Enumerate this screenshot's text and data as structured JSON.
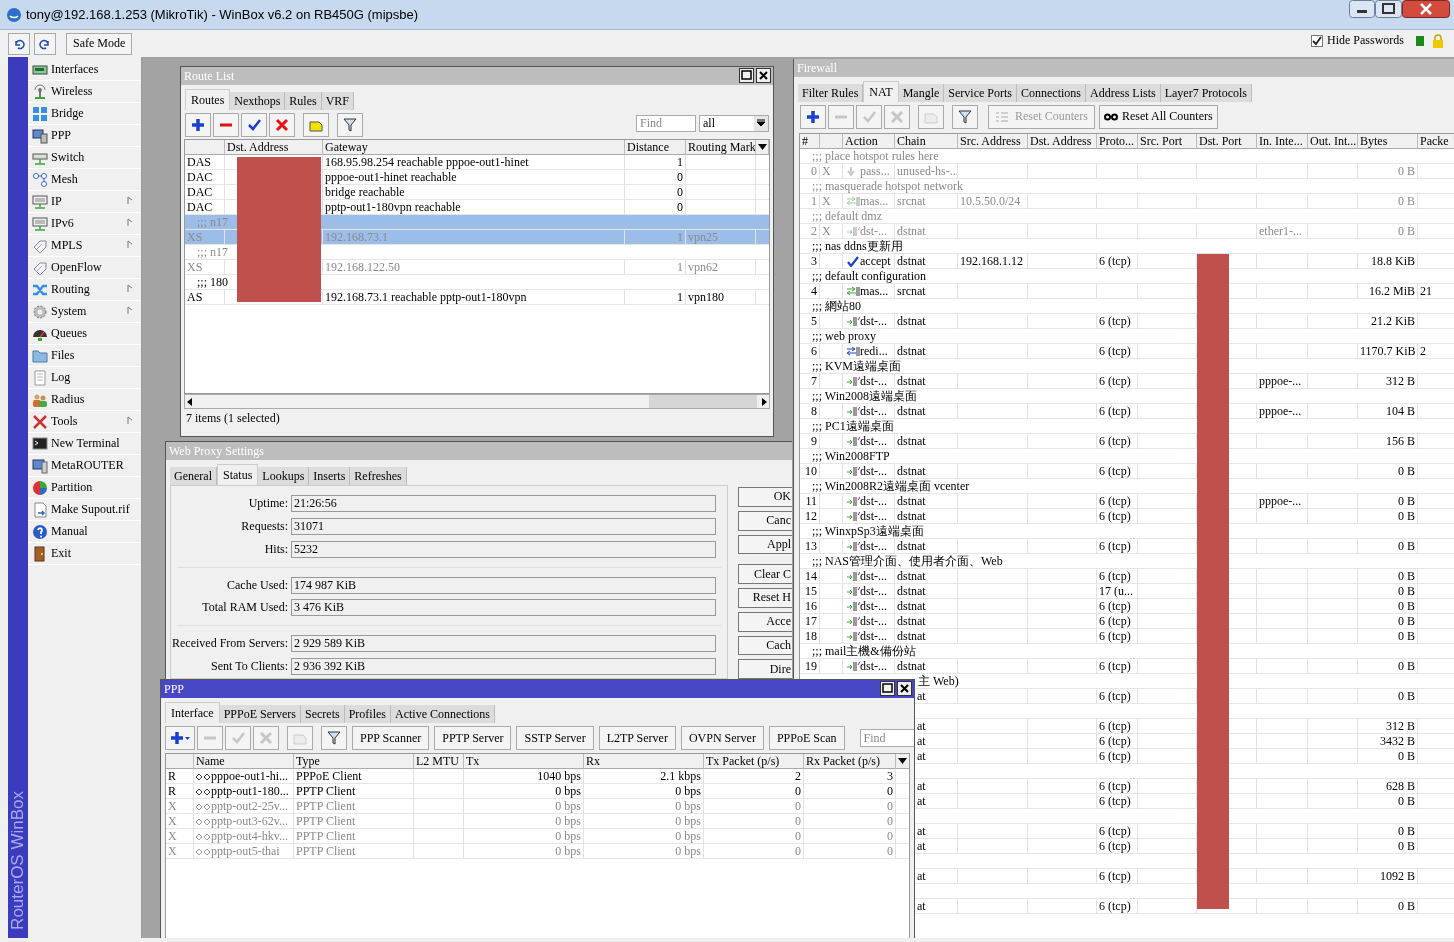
{
  "window": {
    "title": "tony@192.168.1.253 (MikroTik) - WinBox v6.2 on RB450G (mipsbe)"
  },
  "toolbar": {
    "safe_mode": "Safe Mode",
    "hide_passwords": {
      "label": "Hide Passwords",
      "checked": true
    }
  },
  "side_label": "RouterOS WinBox",
  "menu": [
    {
      "label": "Interfaces",
      "kind": "card",
      "submenu": false
    },
    {
      "label": "Wireless",
      "kind": "antenna",
      "submenu": false
    },
    {
      "label": "Bridge",
      "kind": "arrows",
      "submenu": false
    },
    {
      "label": "PPP",
      "kind": "computers",
      "submenu": false
    },
    {
      "label": "Switch",
      "kind": "switch",
      "submenu": false
    },
    {
      "label": "Mesh",
      "kind": "nodes",
      "submenu": false
    },
    {
      "label": "IP",
      "kind": "device",
      "submenu": true
    },
    {
      "label": "IPv6",
      "kind": "device",
      "submenu": true
    },
    {
      "label": "MPLS",
      "kind": "tag",
      "submenu": true
    },
    {
      "label": "OpenFlow",
      "kind": "tag",
      "submenu": false
    },
    {
      "label": "Routing",
      "kind": "crossed",
      "submenu": true
    },
    {
      "label": "System",
      "kind": "gear",
      "submenu": true
    },
    {
      "label": "Queues",
      "kind": "gauge",
      "submenu": false
    },
    {
      "label": "Files",
      "kind": "folder",
      "submenu": false
    },
    {
      "label": "Log",
      "kind": "document",
      "submenu": false
    },
    {
      "label": "Radius",
      "kind": "people",
      "submenu": false
    },
    {
      "label": "Tools",
      "kind": "tools",
      "submenu": true
    },
    {
      "label": "New Terminal",
      "kind": "terminal",
      "submenu": false
    },
    {
      "label": "MetaROUTER",
      "kind": "monitor",
      "submenu": false
    },
    {
      "label": "Partition",
      "kind": "pie",
      "submenu": false
    },
    {
      "label": "Make Supout.rif",
      "kind": "file",
      "submenu": false
    },
    {
      "label": "Manual",
      "kind": "help",
      "submenu": false
    },
    {
      "label": "Exit",
      "kind": "door",
      "submenu": false
    }
  ],
  "route_list": {
    "title": "Route List",
    "active": false,
    "tabs": [
      {
        "label": "Routes",
        "selected": true
      },
      {
        "label": "Nexthops",
        "selected": false
      },
      {
        "label": "Rules",
        "selected": false
      },
      {
        "label": "VRF",
        "selected": false
      }
    ],
    "tools": [
      {
        "kind": "add",
        "disabled": false
      },
      {
        "kind": "remove",
        "disabled": false
      },
      {
        "kind": "enable",
        "disabled": false
      },
      {
        "kind": "disable",
        "disabled": false
      },
      {
        "kind": "comment",
        "disabled": false
      },
      {
        "kind": "filter",
        "disabled": false
      }
    ],
    "find_placeholder": "Find",
    "filter": "all",
    "columns": [
      "Dst. Address",
      "Gateway",
      "Distance",
      "Routing Mark"
    ],
    "rows": [
      {
        "kind": "route",
        "flags": "DAS",
        "gateway": "168.95.98.254 reachable pppoe-out1-hinet",
        "distance": "1",
        "routing_mark": "",
        "selected": false,
        "disabled": false
      },
      {
        "kind": "route",
        "flags": "DAC",
        "gateway": "pppoe-out1-hinet reachable",
        "distance": "0",
        "routing_mark": "",
        "selected": false,
        "disabled": false
      },
      {
        "kind": "route",
        "flags": "DAC",
        "gateway": "bridge reachable",
        "distance": "0",
        "routing_mark": "",
        "selected": false,
        "disabled": false
      },
      {
        "kind": "route",
        "flags": "DAC",
        "gateway": "pptp-out1-180vpn reachable",
        "distance": "0",
        "routing_mark": "",
        "selected": false,
        "disabled": false
      },
      {
        "kind": "comment",
        "text": ";;; n17",
        "selected": true,
        "disabled": true
      },
      {
        "kind": "route",
        "flags": "XS",
        "gateway": "192.168.73.1",
        "distance": "1",
        "routing_mark": "vpn25",
        "selected": true,
        "disabled": true
      },
      {
        "kind": "comment",
        "text": ";;; n17",
        "selected": false,
        "disabled": true
      },
      {
        "kind": "route",
        "flags": "XS",
        "gateway": "192.168.122.50",
        "distance": "1",
        "routing_mark": "vpn62",
        "selected": false,
        "disabled": true
      },
      {
        "kind": "comment",
        "text": ";;; 180",
        "selected": false,
        "disabled": false
      },
      {
        "kind": "route",
        "flags": "AS",
        "gateway": "192.168.73.1 reachable pptp-out1-180vpn",
        "distance": "1",
        "routing_mark": "vpn180",
        "selected": false,
        "disabled": false
      }
    ],
    "status": "7 items (1 selected)"
  },
  "web_proxy": {
    "title": "Web Proxy Settings",
    "active": false,
    "tabs": [
      {
        "label": "General",
        "selected": false
      },
      {
        "label": "Status",
        "selected": true
      },
      {
        "label": "Lookups",
        "selected": false
      },
      {
        "label": "Inserts",
        "selected": false
      },
      {
        "label": "Refreshes",
        "selected": false
      }
    ],
    "groups": [
      [
        {
          "label": "Uptime:",
          "value": "21:26:56"
        },
        {
          "label": "Requests:",
          "value": "31071"
        },
        {
          "label": "Hits:",
          "value": "5232"
        }
      ],
      [
        {
          "label": "Cache Used:",
          "value": "174 987 KiB"
        },
        {
          "label": "Total RAM Used:",
          "value": "3 476 KiB"
        }
      ],
      [
        {
          "label": "Received From Servers:",
          "value": "2 929 589 KiB"
        },
        {
          "label": "Sent To Clients:",
          "value": "2 936 392 KiB"
        }
      ]
    ],
    "buttons": [
      "OK",
      "Canc",
      "Appl",
      "Clear C",
      "Reset H",
      "Acce",
      "Cach",
      "Dire"
    ]
  },
  "firewall": {
    "title": "Firewall",
    "active": false,
    "tabs": [
      {
        "label": "Filter Rules",
        "selected": false
      },
      {
        "label": "NAT",
        "selected": true
      },
      {
        "label": "Mangle",
        "selected": false
      },
      {
        "label": "Service Ports",
        "selected": false
      },
      {
        "label": "Connections",
        "selected": false
      },
      {
        "label": "Address Lists",
        "selected": false
      },
      {
        "label": "Layer7 Protocols",
        "selected": false
      }
    ],
    "tools": [
      {
        "kind": "add",
        "disabled": false
      },
      {
        "kind": "remove",
        "disabled": true
      },
      {
        "kind": "enable",
        "disabled": true
      },
      {
        "kind": "disable",
        "disabled": true
      },
      {
        "kind": "comment",
        "disabled": true
      },
      {
        "kind": "filter",
        "disabled": false
      }
    ],
    "reset_counters": {
      "label": "Reset Counters",
      "disabled": true
    },
    "reset_all_counters": {
      "label": "Reset All Counters",
      "disabled": false
    },
    "columns": [
      "#",
      "",
      "Action",
      "Chain",
      "Src. Address",
      "Dst. Address",
      "Proto...",
      "Src. Port",
      "Dst. Port",
      "In. Inte...",
      "Out. Int...",
      "Bytes",
      "Packe"
    ],
    "rows": [
      {
        "kind": "comment",
        "text": ";;; place hotspot rules here",
        "disabled": true
      },
      {
        "kind": "passthrough",
        "num": "0",
        "flag": "X",
        "action": "pass...",
        "chain": "unused-hs-...",
        "src": "",
        "proto": "",
        "in": "",
        "bytes": "0 B",
        "packets": "",
        "disabled": true
      },
      {
        "kind": "comment",
        "text": ";;; masquerade hotspot network",
        "disabled": true
      },
      {
        "kind": "masquerade",
        "num": "1",
        "flag": "X",
        "action": "mas...",
        "chain": "srcnat",
        "src": "10.5.50.0/24",
        "proto": "",
        "in": "",
        "bytes": "0 B",
        "packets": "",
        "disabled": true
      },
      {
        "kind": "comment",
        "text": ";;; default dmz",
        "disabled": true
      },
      {
        "kind": "dst-nat",
        "num": "2",
        "flag": "X",
        "action": "dst-...",
        "chain": "dstnat",
        "src": "",
        "proto": "",
        "in": "ether1-...",
        "bytes": "0 B",
        "packets": "",
        "disabled": true
      },
      {
        "kind": "comment",
        "text": ";;; nas ddns更新用",
        "disabled": false
      },
      {
        "kind": "accept",
        "num": "3",
        "flag": "",
        "action": "accept",
        "chain": "dstnat",
        "src": "192.168.1.12",
        "proto": "6 (tcp)",
        "in": "",
        "bytes": "18.8 KiB",
        "packets": "",
        "disabled": false
      },
      {
        "kind": "comment",
        "text": ";;; default configuration",
        "disabled": false
      },
      {
        "kind": "masquerade",
        "num": "4",
        "flag": "",
        "action": "mas...",
        "chain": "srcnat",
        "src": "",
        "proto": "",
        "in": "",
        "bytes": "16.2 MiB",
        "packets": "21",
        "disabled": false
      },
      {
        "kind": "comment",
        "text": ";;; 網站80",
        "disabled": false
      },
      {
        "kind": "dst-nat",
        "num": "5",
        "flag": "",
        "action": "dst-...",
        "chain": "dstnat",
        "src": "",
        "proto": "6 (tcp)",
        "in": "",
        "bytes": "21.2 KiB",
        "packets": "",
        "disabled": false
      },
      {
        "kind": "comment",
        "text": ";;; web proxy",
        "disabled": false
      },
      {
        "kind": "redirect",
        "num": "6",
        "flag": "",
        "action": "redi...",
        "chain": "dstnat",
        "src": "",
        "proto": "6 (tcp)",
        "in": "",
        "bytes": "1170.7 KiB",
        "packets": "2",
        "disabled": false
      },
      {
        "kind": "comment",
        "text": ";;; KVM遠端桌面",
        "disabled": false
      },
      {
        "kind": "dst-nat",
        "num": "7",
        "flag": "",
        "action": "dst-...",
        "chain": "dstnat",
        "src": "",
        "proto": "6 (tcp)",
        "in": "pppoe-...",
        "bytes": "312 B",
        "packets": "",
        "disabled": false
      },
      {
        "kind": "comment",
        "text": ";;; Win2008遠端桌面",
        "disabled": false
      },
      {
        "kind": "dst-nat",
        "num": "8",
        "flag": "",
        "action": "dst-...",
        "chain": "dstnat",
        "src": "",
        "proto": "6 (tcp)",
        "in": "pppoe-...",
        "bytes": "104 B",
        "packets": "",
        "disabled": false
      },
      {
        "kind": "comment",
        "text": ";;; PC1遠端桌面",
        "disabled": false
      },
      {
        "kind": "dst-nat",
        "num": "9",
        "flag": "",
        "action": "dst-...",
        "chain": "dstnat",
        "src": "",
        "proto": "6 (tcp)",
        "in": "",
        "bytes": "156 B",
        "packets": "",
        "disabled": false
      },
      {
        "kind": "comment",
        "text": ";;; Win2008FTP",
        "disabled": false
      },
      {
        "kind": "dst-nat",
        "num": "10",
        "flag": "",
        "action": "dst-...",
        "chain": "dstnat",
        "src": "",
        "proto": "6 (tcp)",
        "in": "",
        "bytes": "0 B",
        "packets": "",
        "disabled": false
      },
      {
        "kind": "comment",
        "text": ";;; Win2008R2遠端桌面 vcenter",
        "disabled": false
      },
      {
        "kind": "dst-nat",
        "num": "11",
        "flag": "",
        "action": "dst-...",
        "chain": "dstnat",
        "src": "",
        "proto": "6 (tcp)",
        "in": "pppoe-...",
        "bytes": "0 B",
        "packets": "",
        "disabled": false
      },
      {
        "kind": "dst-nat",
        "num": "12",
        "flag": "",
        "action": "dst-...",
        "chain": "dstnat",
        "src": "",
        "proto": "6 (tcp)",
        "in": "",
        "bytes": "0 B",
        "packets": "",
        "disabled": false
      },
      {
        "kind": "comment",
        "text": ";;; WinxpSp3遠端桌面",
        "disabled": false
      },
      {
        "kind": "dst-nat",
        "num": "13",
        "flag": "",
        "action": "dst-...",
        "chain": "dstnat",
        "src": "",
        "proto": "6 (tcp)",
        "in": "",
        "bytes": "0 B",
        "packets": "",
        "disabled": false
      },
      {
        "kind": "comment",
        "text": ";;; NAS管理介面、使用者介面、Web",
        "disabled": false
      },
      {
        "kind": "dst-nat",
        "num": "14",
        "flag": "",
        "action": "dst-...",
        "chain": "dstnat",
        "src": "",
        "proto": "6 (tcp)",
        "in": "",
        "bytes": "0 B",
        "packets": "",
        "disabled": false
      },
      {
        "kind": "dst-nat",
        "num": "15",
        "flag": "",
        "action": "dst-...",
        "chain": "dstnat",
        "src": "",
        "proto": "17 (u...",
        "in": "",
        "bytes": "0 B",
        "packets": "",
        "disabled": false
      },
      {
        "kind": "dst-nat",
        "num": "16",
        "flag": "",
        "action": "dst-...",
        "chain": "dstnat",
        "src": "",
        "proto": "6 (tcp)",
        "in": "",
        "bytes": "0 B",
        "packets": "",
        "disabled": false
      },
      {
        "kind": "dst-nat",
        "num": "17",
        "flag": "",
        "action": "dst-...",
        "chain": "dstnat",
        "src": "",
        "proto": "6 (tcp)",
        "in": "",
        "bytes": "0 B",
        "packets": "",
        "disabled": false
      },
      {
        "kind": "dst-nat",
        "num": "18",
        "flag": "",
        "action": "dst-...",
        "chain": "dstnat",
        "src": "",
        "proto": "6 (tcp)",
        "in": "",
        "bytes": "0 B",
        "packets": "",
        "disabled": false
      },
      {
        "kind": "comment",
        "text": ";;; mail主機&備份站",
        "disabled": false
      },
      {
        "kind": "dst-nat",
        "num": "19",
        "flag": "",
        "action": "dst-...",
        "chain": "dstnat",
        "src": "",
        "proto": "6 (tcp)",
        "in": "",
        "bytes": "0 B",
        "packets": "",
        "disabled": false
      },
      {
        "kind": "partial-comment",
        "text": "主 Web)"
      },
      {
        "kind": "partial",
        "chain": "at",
        "proto": "6 (tcp)",
        "bytes": "0 B"
      },
      {
        "kind": "blank"
      },
      {
        "kind": "partial",
        "chain": "at",
        "proto": "6 (tcp)",
        "bytes": "312 B"
      },
      {
        "kind": "partial",
        "chain": "at",
        "proto": "6 (tcp)",
        "bytes": "3432 B"
      },
      {
        "kind": "partial",
        "chain": "at",
        "proto": "6 (tcp)",
        "bytes": "0 B"
      },
      {
        "kind": "blank"
      },
      {
        "kind": "partial",
        "chain": "at",
        "proto": "6 (tcp)",
        "bytes": "628 B"
      },
      {
        "kind": "partial",
        "chain": "at",
        "proto": "6 (tcp)",
        "bytes": "0 B"
      },
      {
        "kind": "blank"
      },
      {
        "kind": "partial",
        "chain": "at",
        "proto": "6 (tcp)",
        "bytes": "0 B"
      },
      {
        "kind": "partial",
        "chain": "at",
        "proto": "6 (tcp)",
        "bytes": "0 B"
      },
      {
        "kind": "blank"
      },
      {
        "kind": "partial",
        "chain": "at",
        "proto": "6 (tcp)",
        "bytes": "1092 B"
      },
      {
        "kind": "blank"
      },
      {
        "kind": "partial",
        "chain": "at",
        "proto": "6 (tcp)",
        "bytes": "0 B"
      }
    ]
  },
  "ppp": {
    "title": "PPP",
    "active": true,
    "tabs": [
      {
        "label": "Interface",
        "selected": true
      },
      {
        "label": "PPPoE Servers",
        "selected": false
      },
      {
        "label": "Secrets",
        "selected": false
      },
      {
        "label": "Profiles",
        "selected": false
      },
      {
        "label": "Active Connections",
        "selected": false
      }
    ],
    "tools": [
      {
        "kind": "add-menu",
        "disabled": false
      },
      {
        "kind": "remove",
        "disabled": true
      },
      {
        "kind": "enable",
        "disabled": true
      },
      {
        "kind": "disable",
        "disabled": true
      },
      {
        "kind": "comment",
        "disabled": true
      },
      {
        "kind": "filter",
        "disabled": false
      }
    ],
    "buttons": [
      "PPP Scanner",
      "PPTP Server",
      "SSTP Server",
      "L2TP Server",
      "OVPN Server",
      "PPPoE Scan"
    ],
    "find_placeholder": "Find",
    "columns": [
      "Name",
      "Type",
      "L2 MTU",
      "Tx",
      "Rx",
      "Tx Packet (p/s)",
      "Rx Packet (p/s)"
    ],
    "rows": [
      {
        "flag": "R",
        "name": "pppoe-out1-hi...",
        "type": "PPPoE Client",
        "l2mtu": "",
        "tx": "1040 bps",
        "rx": "2.1 kbps",
        "tx_packets": "2",
        "rx_packets": "3",
        "disabled": false
      },
      {
        "flag": "R",
        "name": "pptp-out1-180...",
        "type": "PPTP Client",
        "l2mtu": "",
        "tx": "0 bps",
        "rx": "0 bps",
        "tx_packets": "0",
        "rx_packets": "0",
        "disabled": false
      },
      {
        "flag": "X",
        "name": "pptp-out2-25v...",
        "type": "PPTP Client",
        "l2mtu": "",
        "tx": "0 bps",
        "rx": "0 bps",
        "tx_packets": "0",
        "rx_packets": "0",
        "disabled": true
      },
      {
        "flag": "X",
        "name": "pptp-out3-62v...",
        "type": "PPTP Client",
        "l2mtu": "",
        "tx": "0 bps",
        "rx": "0 bps",
        "tx_packets": "0",
        "rx_packets": "0",
        "disabled": true
      },
      {
        "flag": "X",
        "name": "pptp-out4-hkv...",
        "type": "PPTP Client",
        "l2mtu": "",
        "tx": "0 bps",
        "rx": "0 bps",
        "tx_packets": "0",
        "rx_packets": "0",
        "disabled": true
      },
      {
        "flag": "X",
        "name": "pptp-out5-thai",
        "type": "PPTP Client",
        "l2mtu": "",
        "tx": "0 bps",
        "rx": "0 bps",
        "tx_packets": "0",
        "rx_packets": "0",
        "disabled": true
      }
    ]
  }
}
